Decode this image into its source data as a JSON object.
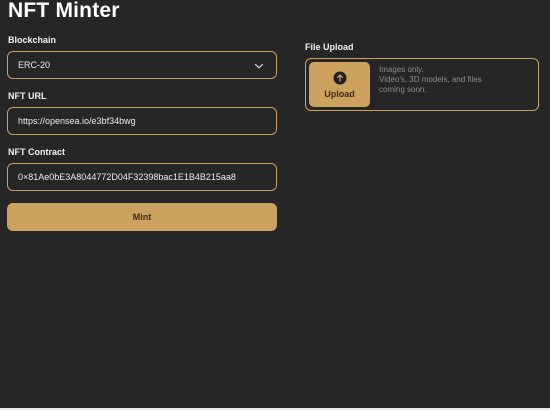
{
  "header": {
    "title": "NFT Minter"
  },
  "form": {
    "blockchain": {
      "label": "Blockchain",
      "value": "ERC-20"
    },
    "nft_url": {
      "label": "NFT URL",
      "value": "https://opensea.io/e3bf34bwg"
    },
    "nft_contract": {
      "label": "NFT Contract",
      "value": "0×81Ae0bE3A8044772D04F32398bac1E1B4B215aa8"
    },
    "mint_label": "Mint"
  },
  "upload": {
    "label": "File Upload",
    "button_label": "Upload",
    "hint_lines": [
      "Images only.",
      "Video's, 3D models, and files",
      "coming soon."
    ]
  },
  "colors": {
    "accent": "#cda25f",
    "background": "#262626",
    "muted_text": "#8c8c8c"
  },
  "icons": {
    "dropdown": "chevron-down-icon",
    "upload": "arrow-up-circle-icon"
  }
}
